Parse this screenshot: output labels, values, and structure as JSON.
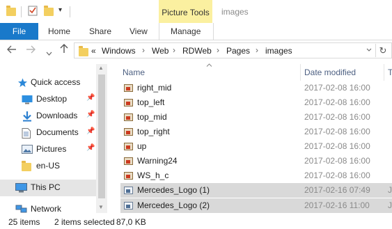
{
  "titlebar": {
    "contextual_group": "Picture Tools",
    "window_title": "images",
    "qa_dropdown_glyph": "▾"
  },
  "ribbon": {
    "tabs": [
      "File",
      "Home",
      "Share",
      "View",
      "Manage"
    ],
    "file_tab_color": "#1979ca",
    "contextual_color": "#fbf0a0"
  },
  "navigation": {
    "back_icon": "back-arrow-icon",
    "forward_icon": "forward-arrow-icon",
    "recent_icon": "chevron-down-icon",
    "up_icon": "up-arrow-icon",
    "overflow": "«",
    "breadcrumb": [
      "Windows",
      "Web",
      "RDWeb",
      "Pages",
      "images"
    ],
    "refresh_glyph": "↻"
  },
  "nav_pane": {
    "quick_access": "Quick access",
    "items": [
      {
        "label": "Desktop",
        "icon": "desktop-icon",
        "pinned": true
      },
      {
        "label": "Downloads",
        "icon": "downloads-icon",
        "pinned": true
      },
      {
        "label": "Documents",
        "icon": "documents-icon",
        "pinned": true
      },
      {
        "label": "Pictures",
        "icon": "pictures-icon",
        "pinned": true
      },
      {
        "label": "en-US",
        "icon": "folder-icon",
        "pinned": false
      }
    ],
    "this_pc": "This PC",
    "network": "Network"
  },
  "file_list": {
    "columns": {
      "name": "Name",
      "date": "Date modified",
      "type": "T"
    },
    "rows": [
      {
        "name": "right_mid",
        "date": "2017-02-08 16:00",
        "type": "",
        "selected": false
      },
      {
        "name": "top_left",
        "date": "2017-02-08 16:00",
        "type": "",
        "selected": false
      },
      {
        "name": "top_mid",
        "date": "2017-02-08 16:00",
        "type": "",
        "selected": false
      },
      {
        "name": "top_right",
        "date": "2017-02-08 16:00",
        "type": "",
        "selected": false
      },
      {
        "name": "up",
        "date": "2017-02-08 16:00",
        "type": "",
        "selected": false
      },
      {
        "name": "Warning24",
        "date": "2017-02-08 16:00",
        "type": "",
        "selected": false
      },
      {
        "name": "WS_h_c",
        "date": "2017-02-08 16:00",
        "type": "",
        "selected": false
      },
      {
        "name": "Mercedes_Logo (1)",
        "date": "2017-02-16 07:49",
        "type": "JI",
        "selected": true
      },
      {
        "name": "Mercedes_Logo (2)",
        "date": "2017-02-16 11:00",
        "type": "JI",
        "selected": true
      }
    ]
  },
  "status": {
    "count": "25 items",
    "selection": "2 items selected",
    "size": "87,0 KB"
  }
}
